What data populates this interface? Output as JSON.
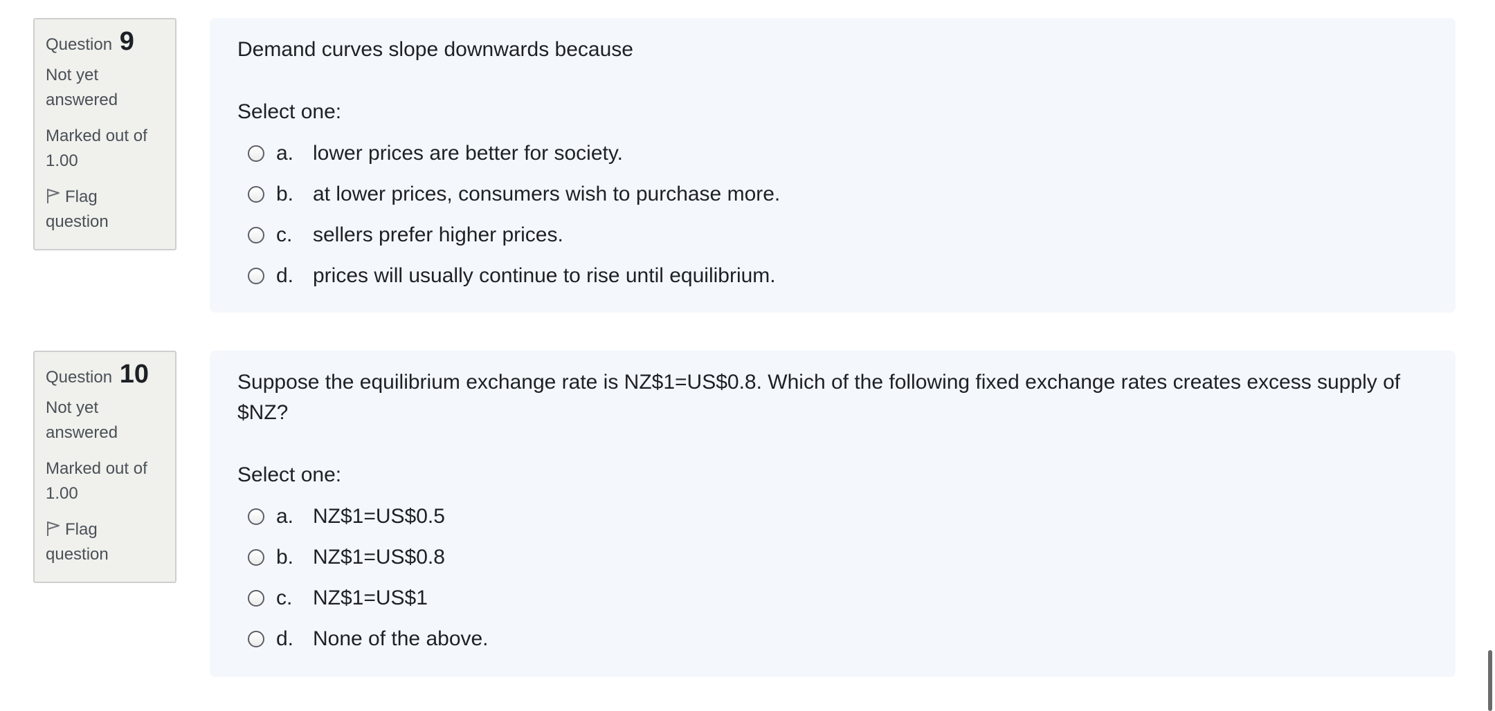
{
  "questions": [
    {
      "info": {
        "label": "Question",
        "number": "9",
        "state_line1": "Not yet",
        "state_line2": "answered",
        "grade_line1": "Marked out of",
        "grade_line2": "1.00",
        "flag_line1": "Flag",
        "flag_line2": "question",
        "flag_icon": "flag-icon"
      },
      "text": "Demand curves slope downwards because",
      "prompt": "Select one:",
      "options": [
        {
          "letter": "a.",
          "text": "lower prices are better for society."
        },
        {
          "letter": "b.",
          "text": "at lower prices, consumers wish to purchase more."
        },
        {
          "letter": "c.",
          "text": "sellers prefer higher prices."
        },
        {
          "letter": "d.",
          "text": "prices will usually continue to rise until equilibrium."
        }
      ]
    },
    {
      "info": {
        "label": "Question",
        "number": "10",
        "state_line1": "Not yet",
        "state_line2": "answered",
        "grade_line1": "Marked out of",
        "grade_line2": "1.00",
        "flag_line1": "Flag",
        "flag_line2": "question",
        "flag_icon": "flag-icon"
      },
      "text": "Suppose the equilibrium exchange rate is NZ$1=US$0.8. Which of the following fixed exchange rates creates excess supply of $NZ?",
      "prompt": "Select one:",
      "options": [
        {
          "letter": "a.",
          "text": "NZ$1=US$0.5"
        },
        {
          "letter": "b.",
          "text": "NZ$1=US$0.8"
        },
        {
          "letter": "c.",
          "text": "NZ$1=US$1"
        },
        {
          "letter": "d.",
          "text": "None of the above."
        }
      ]
    }
  ]
}
